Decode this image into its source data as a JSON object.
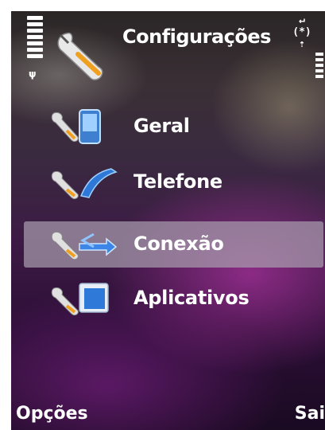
{
  "header": {
    "title": "Configurações",
    "icon": "settings-wrench-icon"
  },
  "status": {
    "signal_icon": "antenna-icon",
    "battery_icon": "battery-indicator",
    "indicator_icons": [
      "return-arrow-icon",
      "bluetooth-icon",
      "upload-icon"
    ]
  },
  "menu": {
    "selected_index": 2,
    "items": [
      {
        "label": "Geral",
        "icon": "phone-device-icon"
      },
      {
        "label": "Telefone",
        "icon": "telephone-handset-icon"
      },
      {
        "label": "Conexão",
        "icon": "connection-arrows-icon"
      },
      {
        "label": "Aplicativos",
        "icon": "applications-box-icon"
      }
    ]
  },
  "softkeys": {
    "left": "Opções",
    "right": "Sai"
  },
  "colors": {
    "text": "#ffffff",
    "selection": "#aaa0af",
    "accent_blue": "#2e78d8",
    "wrench_handle": "#f0a020"
  }
}
